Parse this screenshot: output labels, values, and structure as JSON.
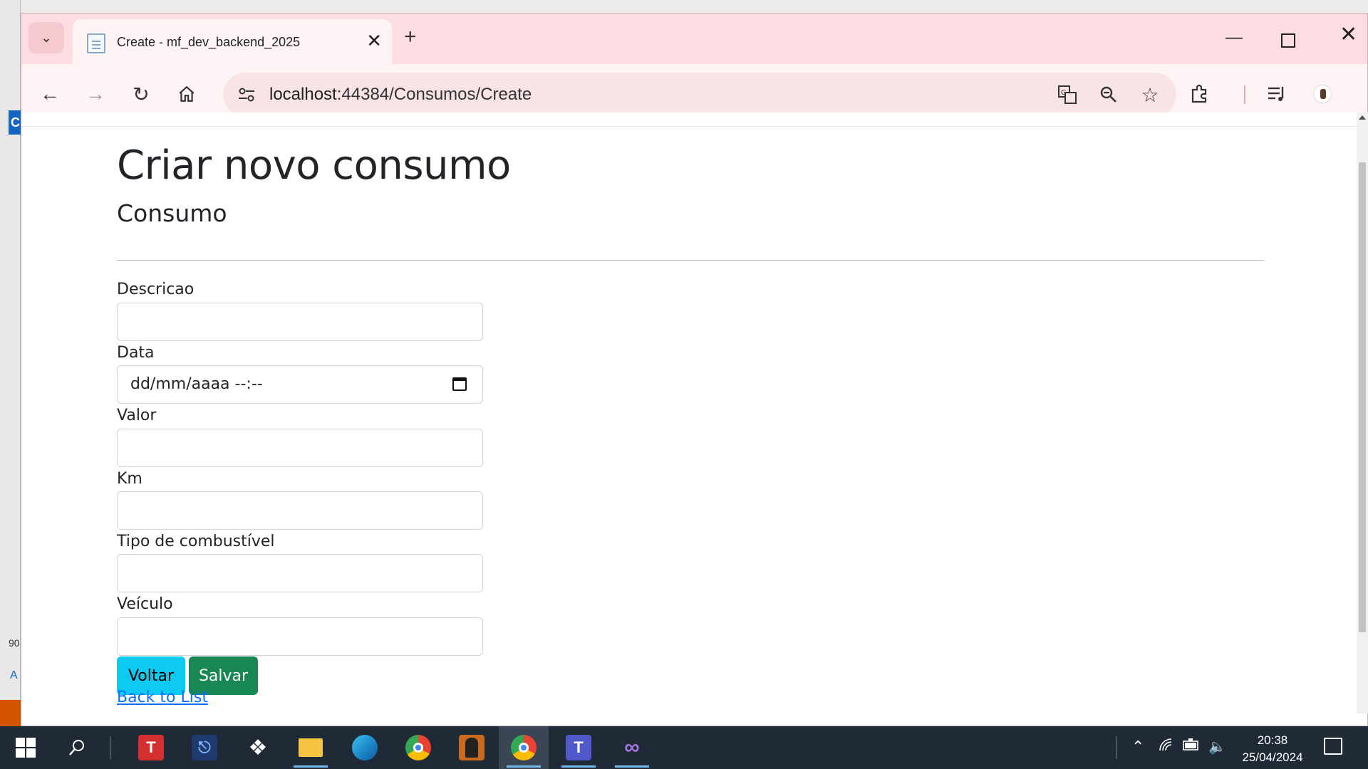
{
  "browser": {
    "tab_title": "Create - mf_dev_backend_2025",
    "url_host": "localhost",
    "url_path": ":44384/Consumos/Create"
  },
  "page": {
    "heading": "Criar novo consumo",
    "subheading": "Consumo",
    "fields": [
      {
        "label": "Descricao",
        "value": ""
      },
      {
        "label": "Data",
        "value": "dd/mm/aaaa --:--"
      },
      {
        "label": "Valor",
        "value": ""
      },
      {
        "label": "Km",
        "value": ""
      },
      {
        "label": "Tipo de combustível",
        "value": ""
      },
      {
        "label": "Veículo",
        "value": ""
      }
    ],
    "buttons": {
      "back": "Voltar",
      "save": "Salvar"
    },
    "back_link": "Back to List"
  },
  "background_window": {
    "letter": "C",
    "number": "90",
    "link_letter": "A"
  },
  "taskbar": {
    "time": "20:38",
    "date": "25/04/2024"
  },
  "colors": {
    "tab_strip": "#fddde2",
    "toolbar": "#fff4f5",
    "btn_voltar": "#0dcaf0",
    "btn_salvar": "#198754",
    "link": "#0d6efd",
    "taskbar": "#202a36"
  }
}
